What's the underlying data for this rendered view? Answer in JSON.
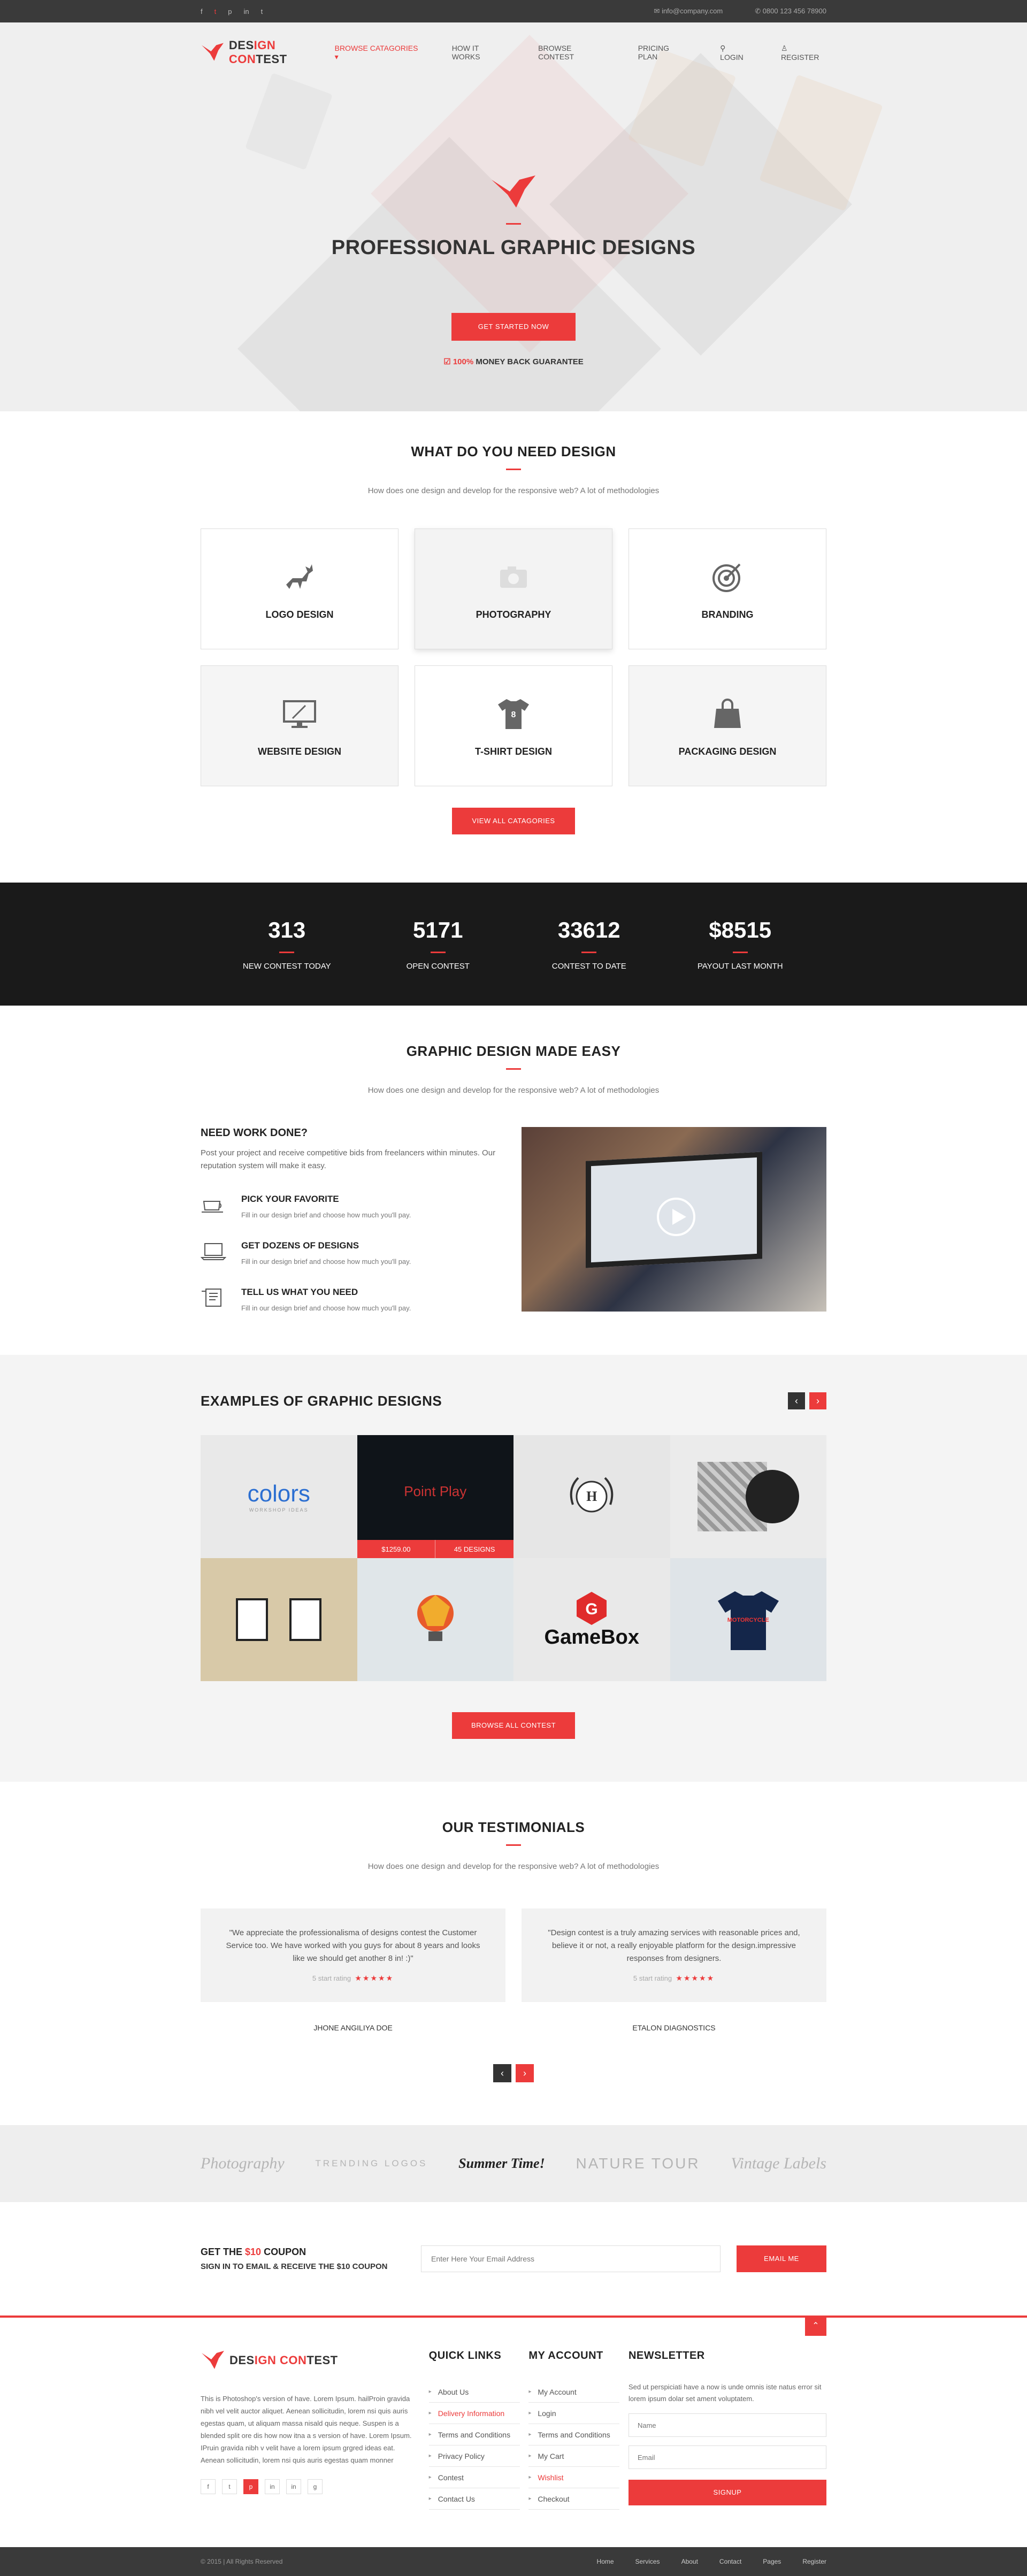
{
  "topbar": {
    "socials": [
      "f",
      "t",
      "p",
      "in",
      "t"
    ],
    "email": "info@company.com",
    "phone": "0800 123 456 78900"
  },
  "brand": {
    "name_a": "DES",
    "name_b": "IGN CON",
    "name_c": "TEST",
    "full": "DESIGN CONTEST"
  },
  "nav": {
    "items": [
      "BROWSE CATAGORIES ▾",
      "HOW IT WORKS",
      "BROWSE CONTEST",
      "PRICING PLAN",
      "LOGIN",
      "REGISTER"
    ]
  },
  "hero": {
    "title": "PROFESSIONAL GRAPHIC DESIGNS",
    "cta": "GET STARTED NOW",
    "guarantee_pct": "100%",
    "guarantee_text": "MONEY BACK GUARANTEE"
  },
  "categories": {
    "title": "WHAT DO YOU NEED DESIGN",
    "subtitle": "How does one design and develop for the responsive web? A lot of methodologies",
    "items": [
      {
        "label": "LOGO DESIGN",
        "icon": "deer-icon"
      },
      {
        "label": "PHOTOGRAPHY",
        "icon": "camera-icon"
      },
      {
        "label": "BRANDING",
        "icon": "target-icon"
      },
      {
        "label": "WEBSITE DESIGN",
        "icon": "monitor-icon"
      },
      {
        "label": "T-SHIRT DESIGN",
        "icon": "tshirt-icon"
      },
      {
        "label": "PACKAGING DESIGN",
        "icon": "bag-icon"
      }
    ],
    "button": "VIEW ALL CATAGORIES"
  },
  "stats": [
    {
      "n": "313",
      "l": "NEW CONTEST TODAY"
    },
    {
      "n": "5171",
      "l": "OPEN CONTEST"
    },
    {
      "n": "33612",
      "l": "CONTEST TO DATE"
    },
    {
      "n": "$8515",
      "l": "PAYOUT LAST MONTH"
    }
  ],
  "easy": {
    "title": "GRAPHIC DESIGN MADE EASY",
    "subtitle": "How does one design and develop for the responsive web? A lot of methodologies",
    "heading": "NEED WORK DONE?",
    "intro": "Post your project and receive competitive bids from freelancers within minutes. Our reputation system will make it easy.",
    "steps": [
      {
        "t": "PICK YOUR FAVORITE",
        "d": "Fill in our design brief and choose how much you'll pay."
      },
      {
        "t": "GET DOZENS OF DESIGNS",
        "d": "Fill in our design brief and choose how much you'll pay."
      },
      {
        "t": "TELL US WHAT YOU NEED",
        "d": "Fill in our design brief and choose how much you'll pay."
      }
    ]
  },
  "examples": {
    "title": "EXAMPLES OF GRAPHIC DESIGNS",
    "items": [
      "colors",
      "Point Play",
      "H",
      "",
      "",
      "",
      "GameBox",
      "MOTORCYCLE"
    ],
    "sub_colors": "WORKSHOP IDEAS",
    "price": "$1259.00",
    "designs": "45 DESIGNS",
    "button": "BROWSE ALL CONTEST"
  },
  "testimonials": {
    "title": "OUR TESTIMONIALS",
    "subtitle": "How does one design and develop for the responsive web? A lot of methodologies",
    "items": [
      {
        "quote": "\"We appreciate the professionalisma of designs contest the Customer Service too. We have worked with you guys for about 8 years and looks like we should get another 8 in! :)\"",
        "rate": "5 start rating",
        "stars": "★★★★★",
        "name": "JHONE ANGILIYA DOE"
      },
      {
        "quote": "\"Design contest is a truly amazing services with reasonable prices and, believe it or not, a really enjoyable platform for the design.impressive responses from designers.",
        "rate": "5 start rating",
        "stars": "★★★★★",
        "name": "ETALON DIAGNOSTICS"
      }
    ]
  },
  "partners": [
    "Photography",
    "TRENDING LOGOS",
    "Summer Time!",
    "NATURE TOUR",
    "Vintage Labels"
  ],
  "coupon": {
    "title_a": "GET THE ",
    "title_b": "$10",
    "title_c": " COUPON",
    "sub": "SIGN IN TO EMAIL & RECEIVE THE $10 COUPON",
    "placeholder": "Enter Here Your Email Address",
    "button": "EMAIL ME"
  },
  "footer": {
    "about": "This is Photoshop's version of have. Lorem Ipsum. hailProin gravida nibh vel velit auctor aliquet. Aenean sollicitudin, lorem nsi quis auris egestas quam, ut aliquam massa nisald quis neque. Suspen is a blended split ore dis how now itna a s version of have. Lorem Ipsum. IPruin gravida nibh v velit have a lorem ipsum grgred ideas eat. Aenean sollicitudin, lorem nsi quis auris egestas quam monner",
    "socials": [
      "f",
      "t",
      "p",
      "in",
      "in",
      "g"
    ],
    "quick_title": "QUICK LINKS",
    "quick": [
      "About Us",
      "Delivery Information",
      "Terms and Conditions",
      "Privacy Policy",
      "Contest",
      "Contact Us"
    ],
    "account_title": "MY ACCOUNT",
    "account": [
      "My Account",
      "Login",
      "Terms and Conditions",
      "My Cart",
      "Wishlist",
      "Checkout"
    ],
    "news_title": "NEWSLETTER",
    "news_text": "Sed ut perspiciati have a now is unde omnis iste natus error sit lorem ipsum dolar set ament voluptatem.",
    "name_ph": "Name",
    "email_ph": "Email",
    "signup": "SIGNUP"
  },
  "bottom": {
    "copy": "© 2015 | All Rights Reserved",
    "links": [
      "Home",
      "Services",
      "About",
      "Contact",
      "Pages",
      "Register"
    ]
  },
  "colors": {
    "accent": "#ec3b3b",
    "dark": "#3a3a3a"
  }
}
